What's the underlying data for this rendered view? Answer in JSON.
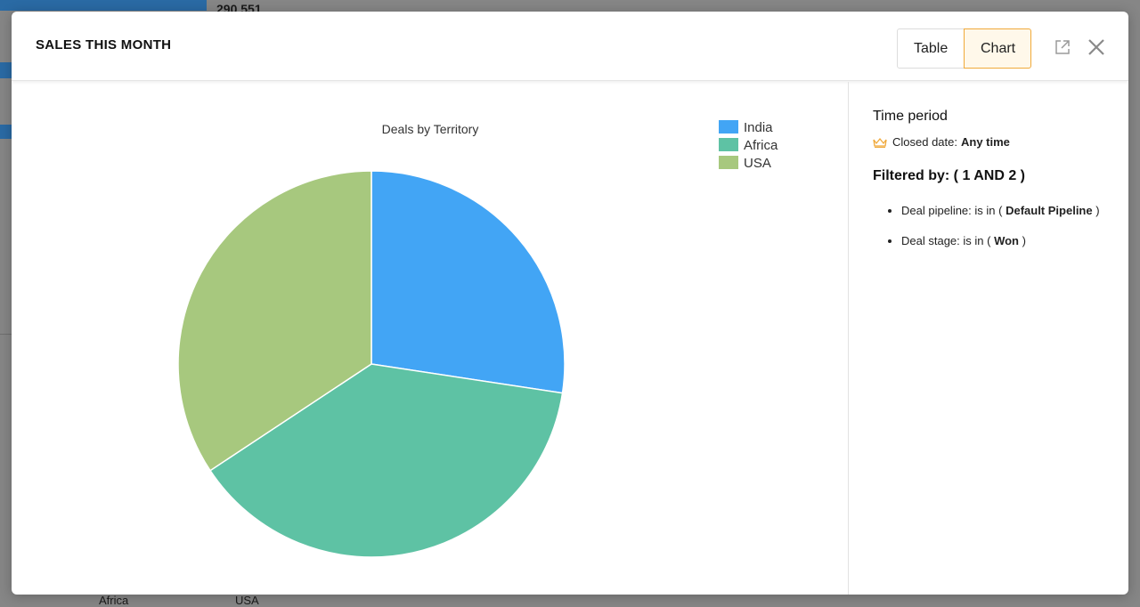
{
  "background": {
    "top_number": "290 551",
    "bottom_labels": [
      "Africa",
      "USA"
    ]
  },
  "modal": {
    "title": "SALES THIS MONTH",
    "toggle": {
      "table": "Table",
      "chart": "Chart",
      "active": "chart"
    },
    "icons": {
      "popout": "external-link-icon",
      "close": "close-icon"
    }
  },
  "colors": {
    "India": "#42a5f5",
    "Africa": "#5ec2a4",
    "USA": "#a7c87e",
    "accent": "#f0a93a"
  },
  "chart_data": {
    "type": "pie",
    "title": "Deals by Territory",
    "categories": [
      "India",
      "Africa",
      "USA"
    ],
    "values": [
      27.4,
      38.3,
      34.3
    ],
    "legend": "top-right"
  },
  "sidebar": {
    "time_period_heading": "Time period",
    "closed_date_label": "Closed date:",
    "closed_date_value": "Any time",
    "filtered_by": "Filtered by: ( 1 AND 2 )",
    "filters": [
      {
        "prefix": "Deal pipeline: is in (",
        "value": "Default Pipeline",
        "suffix": ")"
      },
      {
        "prefix": "Deal stage: is in (",
        "value": "Won",
        "suffix": ")"
      }
    ]
  }
}
